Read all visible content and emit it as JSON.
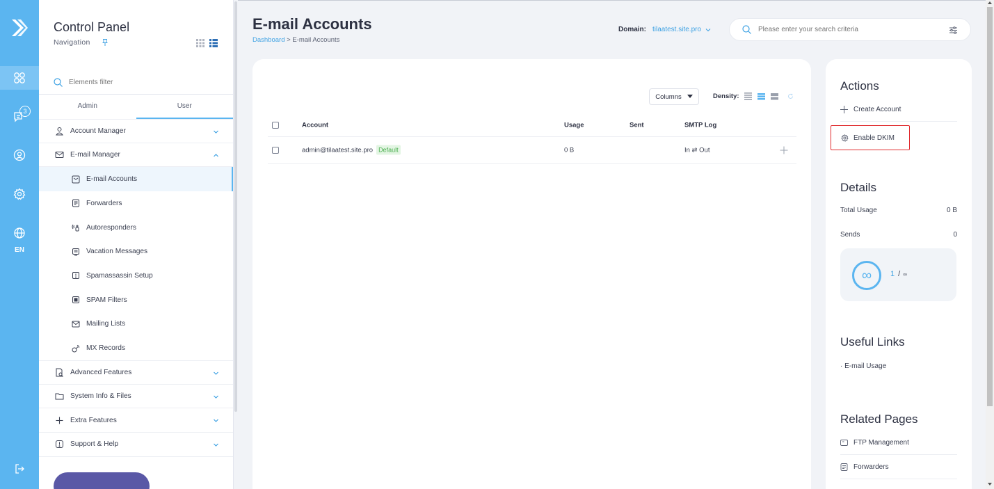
{
  "nav": {
    "title": "Control Panel",
    "subtitle": "Navigation",
    "filter_placeholder": "Elements filter",
    "tabs": [
      {
        "label": "Admin"
      },
      {
        "label": "User"
      }
    ],
    "menu": {
      "account_manager": "Account Manager",
      "email_manager": "E-mail Manager",
      "sub": [
        {
          "label": "E-mail Accounts"
        },
        {
          "label": "Forwarders"
        },
        {
          "label": "Autoresponders"
        },
        {
          "label": "Vacation Messages"
        },
        {
          "label": "Spamassassin Setup"
        },
        {
          "label": "SPAM Filters"
        },
        {
          "label": "Mailing Lists"
        },
        {
          "label": "MX Records"
        }
      ],
      "advanced": "Advanced Features",
      "system": "System Info & Files",
      "extra": "Extra Features",
      "support": "Support & Help"
    }
  },
  "rail": {
    "lang": "EN",
    "messages_badge": "3"
  },
  "header": {
    "title": "E-mail Accounts",
    "breadcrumb_home": "Dashboard",
    "breadcrumb_sep": " > ",
    "breadcrumb_current": "E-mail Accounts",
    "domain_label": "Domain:",
    "domain_value": "tilaatest.site.pro",
    "search_placeholder": "Please enter your search criteria"
  },
  "table": {
    "columns_button": "Columns",
    "density_label": "Density:",
    "headers": {
      "account": "Account",
      "usage": "Usage",
      "sent": "Sent",
      "smtp": "SMTP Log"
    },
    "rows": [
      {
        "account": "admin@tilaatest.site.pro",
        "badge": "Default",
        "usage": "0 B",
        "sent": "",
        "smtp": "In ⇄ Out"
      }
    ]
  },
  "actions": {
    "title": "Actions",
    "create": "Create Account",
    "dkim": "Enable DKIM"
  },
  "details": {
    "title": "Details",
    "total_usage_label": "Total Usage",
    "total_usage_value": "0 B",
    "sends_label": "Sends",
    "sends_value": "0",
    "quota_used": "1",
    "quota_sep": "/",
    "quota_limit": "∞"
  },
  "useful_links": {
    "title": "Useful Links",
    "items": [
      {
        "label": "· E-mail Usage"
      }
    ]
  },
  "related": {
    "title": "Related Pages",
    "items": [
      {
        "label": "FTP Management"
      },
      {
        "label": "Forwarders"
      }
    ]
  },
  "colors": {
    "accent": "#5bb5f0",
    "link": "#3fa2e3",
    "highlight": "#e0282c",
    "success": "#4caf50"
  }
}
